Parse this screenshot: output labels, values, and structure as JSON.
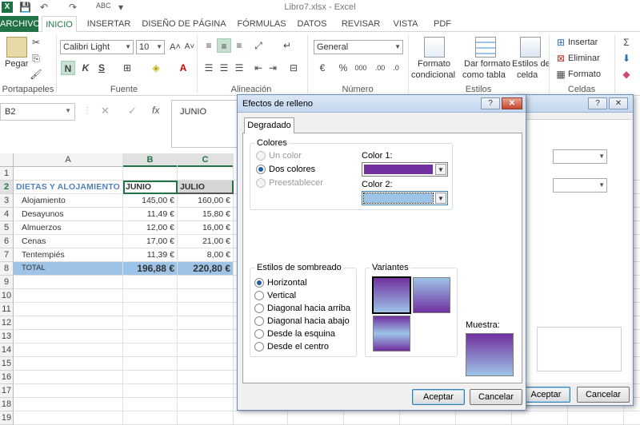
{
  "window": {
    "title": "Libro7.xlsx - Excel",
    "app_icon": "X"
  },
  "tabs": [
    "ARCHIVO",
    "INICIO",
    "INSERTAR",
    "DISEÑO DE PÁGINA",
    "FÓRMULAS",
    "DATOS",
    "REVISAR",
    "VISTA",
    "PDF"
  ],
  "ribbon": {
    "clipboard": {
      "paste": "Pegar",
      "group": "Portapapeles"
    },
    "font": {
      "name": "Calibri Light",
      "size": "10",
      "bold": "N",
      "italic": "K",
      "underline": "S",
      "grow": "A˄",
      "shrink": "A˅",
      "group": "Fuente"
    },
    "alignment": {
      "group": "Alineación"
    },
    "number": {
      "format": "General",
      "currency": "€",
      "percent": "%",
      "thousands": "000",
      "group": "Número"
    },
    "styles": {
      "cond1": "Formato",
      "cond2": "condicional",
      "table1": "Dar formato",
      "table2": "como tabla",
      "cell1": "Estilos de",
      "cell2": "celda",
      "group": "Estilos"
    },
    "cells": {
      "insert": "Insertar",
      "delete": "Eliminar",
      "format": "Formato",
      "group": "Celdas"
    }
  },
  "formula_bar": {
    "name_box": "B2",
    "fx": "fx",
    "value": "JUNIO"
  },
  "sheet": {
    "columns": [
      "A",
      "B",
      "C"
    ],
    "rows": [
      "1",
      "2",
      "3",
      "4",
      "5",
      "6",
      "7",
      "8",
      "9",
      "10",
      "11",
      "12",
      "13",
      "14",
      "15",
      "16",
      "17",
      "18",
      "19"
    ],
    "header_row": {
      "a": "DIETAS Y ALOJAMIENTO",
      "b": "JUNIO",
      "c": "JULIO"
    },
    "data": [
      {
        "label": "Alojamiento",
        "b": "145,00 €",
        "c": "160,00 €"
      },
      {
        "label": "Desayunos",
        "b": "11,49 €",
        "c": "15,80 €"
      },
      {
        "label": "Almuerzos",
        "b": "12,00 €",
        "c": "16,00 €"
      },
      {
        "label": "Cenas",
        "b": "17,00 €",
        "c": "21,00 €"
      },
      {
        "label": "Tentempiés",
        "b": "11,39 €",
        "c": "8,00 €"
      }
    ],
    "total": {
      "label": "TOTAL",
      "b": "196,88 €",
      "c": "220,80 €"
    }
  },
  "back_dialog": {
    "help": "?",
    "close": "✕",
    "ok": "Aceptar",
    "cancel": "Cancelar"
  },
  "fill_dialog": {
    "title": "Efectos de relleno",
    "help": "?",
    "close": "✕",
    "tab": "Degradado",
    "colors_group": "Colores",
    "color_options": [
      {
        "label": "Un color",
        "state": "disabled"
      },
      {
        "label": "Dos colores",
        "state": "selected"
      },
      {
        "label": "Preestablecer",
        "state": "disabled"
      }
    ],
    "color1_label": "Color 1:",
    "color2_label": "Color 2:",
    "color1": "#7030a0",
    "color2": "#9dc3e6",
    "shading_group": "Estilos de sombreado",
    "shading_options": [
      "Horizontal",
      "Vertical",
      "Diagonal hacia arriba",
      "Diagonal hacia abajo",
      "Desde la esquina",
      "Desde el centro"
    ],
    "shading_selected": "Horizontal",
    "variants_label": "Variantes",
    "sample_label": "Muestra:",
    "ok": "Aceptar",
    "cancel": "Cancelar"
  },
  "colors": {
    "excel_green": "#217346",
    "header_blue": "#4f81bd",
    "total_fill": "#9dc3e6"
  }
}
